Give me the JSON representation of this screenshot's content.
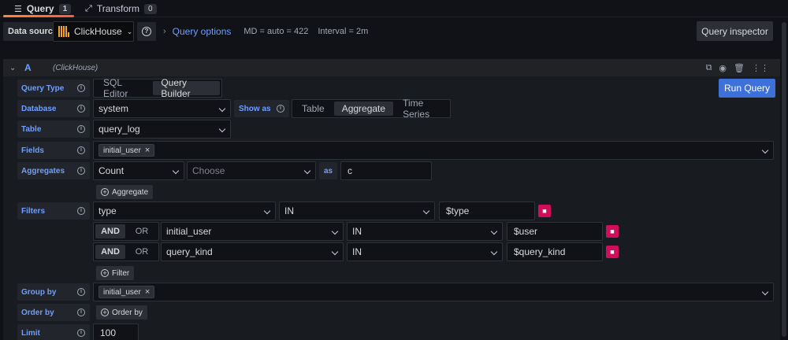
{
  "tabs": [
    {
      "label": "Query",
      "count": "1",
      "icon": "database-icon"
    },
    {
      "label": "Transform",
      "count": "0",
      "icon": "transform-icon"
    }
  ],
  "datasource": {
    "label": "Data source",
    "value": "ClickHouse"
  },
  "query_options": {
    "title": "Query options",
    "md": "MD = auto = 422",
    "interval": "Interval = 2m"
  },
  "query_inspector_label": "Query inspector",
  "query": {
    "name": "A",
    "datasource": "(ClickHouse)"
  },
  "run_query_label": "Run Query",
  "labels": {
    "query_type": "Query Type",
    "database": "Database",
    "show_as": "Show as",
    "table": "Table",
    "fields": "Fields",
    "aggregates": "Aggregates",
    "as": "as",
    "filters": "Filters",
    "group_by": "Group by",
    "order_by": "Order by",
    "limit": "Limit"
  },
  "query_type_options": [
    "SQL Editor",
    "Query Builder"
  ],
  "query_type_selected": "Query Builder",
  "database_value": "system",
  "show_as_options": [
    "Table",
    "Aggregate",
    "Time Series"
  ],
  "show_as_selected": "Aggregate",
  "table_value": "query_log",
  "fields": [
    "initial_user"
  ],
  "aggregate": {
    "function": "Count",
    "column_placeholder": "Choose",
    "alias": "c"
  },
  "add_aggregate_label": "Aggregate",
  "filters": [
    {
      "field": "type",
      "operator": "IN",
      "value": "$type"
    },
    {
      "logic": "AND",
      "alt_logic": "OR",
      "field": "initial_user",
      "operator": "IN",
      "value": "$user"
    },
    {
      "logic": "AND",
      "alt_logic": "OR",
      "field": "query_kind",
      "operator": "IN",
      "value": "$query_kind"
    }
  ],
  "add_filter_label": "Filter",
  "group_by": [
    "initial_user"
  ],
  "add_order_by_label": "Order by",
  "limit_value": "100",
  "colors": {
    "accent": "#6e9fff",
    "run": "#3d71d9",
    "danger": "#d10e5c",
    "tab_underline": "#ff8833"
  }
}
